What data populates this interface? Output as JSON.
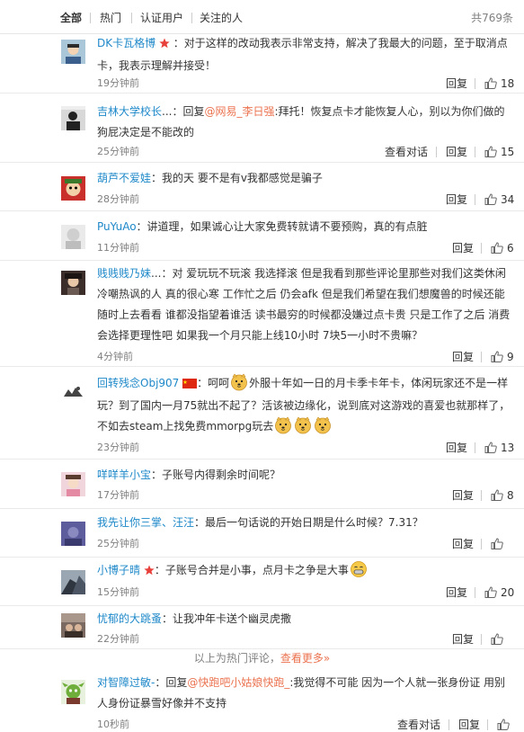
{
  "tabs": [
    {
      "label": "全部"
    },
    {
      "label": "热门"
    },
    {
      "label": "认证用户"
    },
    {
      "label": "关注的人"
    }
  ],
  "total": "共769条",
  "actions": {
    "reply": "回复",
    "view_conv": "查看对话"
  },
  "comments": [
    {
      "user": "DK卡瓦格博",
      "text": "：对于这样的改动我表示非常支持，解决了我最大的问题，至于取消点卡，我表示理解并接受！",
      "time": "19分钟前",
      "likes": "18"
    },
    {
      "user": "吉林大学校长",
      "reply_prefix": "：回复",
      "reply_to": "@网易_李日强",
      "text": ":拜托！恢复点卡才能恢复人心，别以为你们做的狗屁决定是不能改的",
      "time": "25分钟前",
      "likes": "15"
    },
    {
      "user": "葫芦不爱娃",
      "text": "：我的天 要不是有v我都感觉是骗子",
      "time": "28分钟前",
      "likes": "34"
    },
    {
      "user": "PuYuAo",
      "text": "：讲道理，如果诚心让大家免费转就请不要预购，真的有点脏",
      "time": "11分钟前",
      "likes": "6"
    },
    {
      "user": "贱贱贱乃妹",
      "text": "：对 爱玩玩不玩滚 我选择滚 但是我看到那些评论里那些对我们这类休闲冷嘲热讽的人 真的很心寒 工作忙之后 仍会afk 但是我们希望在我们想魔兽的时候还能随时上去看看 谁都没指望着谁活 读书最穷的时候都没嫌过点卡贵 只是工作了之后 消费会选择更理性吧 如果我一个月只能上线10小时 7块5一小时不贵嘛？",
      "time": "4分钟前",
      "likes": "9"
    },
    {
      "user": "回转残念Obj907",
      "text_a": "：呵呵",
      "text_b": "外服十年如一日的月卡季卡年卡，体闲玩家还不是一样玩？到了国内一月75就出不起了？活该被边缘化，说到底对这游戏的喜爱也就那样了，不如去steam上找免费mmorpg玩去",
      "time": "23分钟前",
      "likes": "13"
    },
    {
      "user": "咩咩羊小宝",
      "text": "：子账号内得剩余时间呢？",
      "time": "17分钟前",
      "likes": "8"
    },
    {
      "user": "我先让你三掌、汪汪",
      "text": "：最后一句话说的开始日期是什么时候？7.31？",
      "time": "25分钟前",
      "likes": ""
    },
    {
      "user": "小博子晴",
      "text": "：子账号合并是小事，点月卡之争是大事",
      "time": "15分钟前",
      "likes": "20"
    },
    {
      "user": "忧郁的大跳蚤",
      "text": "：让我冲年卡送个幽灵虎撒",
      "time": "22分钟前",
      "likes": ""
    },
    {
      "user": "对智障过敏-",
      "reply_prefix": "：回复",
      "reply_to": "@快跑吧小姑娘快跑_",
      "text": ":我觉得不可能 因为一个人就一张身份证 用别人身份证暴雪好像并不支持",
      "time": "10秒前",
      "likes": ""
    }
  ],
  "hot_footer": {
    "text": "以上为热门评论，",
    "more": "查看更多»"
  }
}
